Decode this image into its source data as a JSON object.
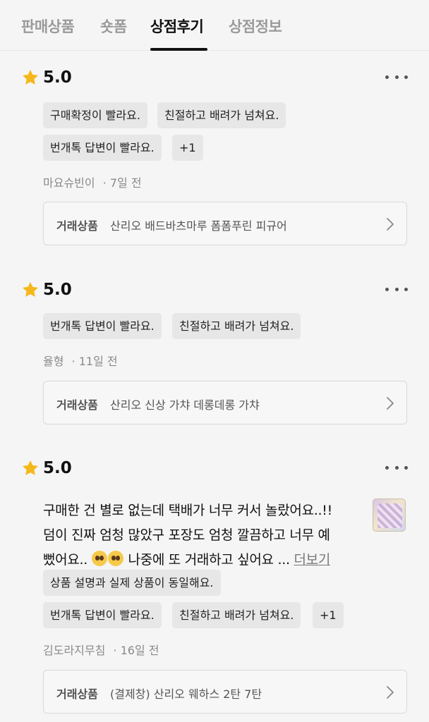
{
  "tabs": [
    {
      "label": "판매상품"
    },
    {
      "label": "숏폼"
    },
    {
      "label": "상점후기"
    },
    {
      "label": "상점정보"
    }
  ],
  "active_tab": "상점후기",
  "colors": {
    "star": "#f5b81c",
    "text": "#111111",
    "muted": "#8a8a8a",
    "chip_bg": "#e7e7e7"
  },
  "icons": {
    "star": "star-icon",
    "more": "more-dots-icon",
    "chevron": "chevron-right-icon"
  },
  "product_label": "거래상품",
  "reviews": [
    {
      "rating": "5.0",
      "tags": [
        "구매확정이 빨라요.",
        "친절하고 배려가 넘쳐요.",
        "번개톡 답변이 빨라요.",
        "+1"
      ],
      "reviewer": "마요슈빈이",
      "time": "· 7일 전",
      "product": "산리오 배드바츠마루 폼폼푸린 피규어"
    },
    {
      "rating": "5.0",
      "tags": [
        "번개톡 답변이 빨라요.",
        "친절하고 배려가 넘쳐요."
      ],
      "reviewer": "율형",
      "time": "· 11일 전",
      "product": "산리오 신상 가챠 데롱데롱 가챠"
    },
    {
      "rating": "5.0",
      "text_lines": [
        "구매한 건 별로 없는데 택배가 너무 커서 놀랐어요..!!",
        "덤이 진짜 엄청 많았구 포장도 엄청 깔끔하고 너무 예",
        "뻤어요..",
        "나중에 또 거래하고 싶어요  ..."
      ],
      "read_more": "더보기",
      "tags": [
        "상품 설명과 실제 상품이 동일해요.",
        "번개톡 답변이 빨라요.",
        "친절하고 배려가 넘쳐요.",
        "+1"
      ],
      "reviewer": "김도라지무침",
      "time": "· 16일 전",
      "product": "(결제창) 산리오 웨하스 2탄 7탄"
    }
  ]
}
